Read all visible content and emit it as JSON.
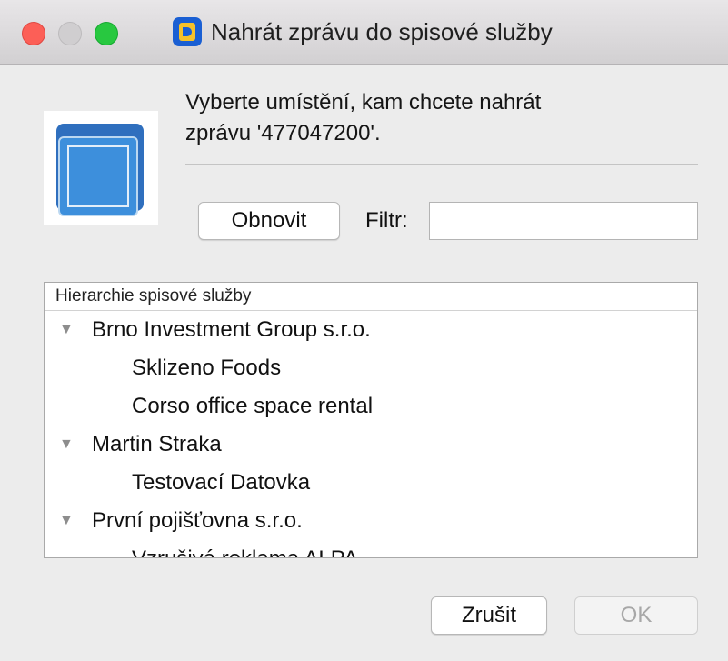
{
  "window": {
    "title": "Nahrát zprávu do spisové služby",
    "traffic_colors": {
      "close": "#fc5f57",
      "minimize": "#d0ced0",
      "maximize": "#28c840"
    }
  },
  "prompt": {
    "line1": "Vyberte umístění, kam chcete nahrát",
    "line2": "zprávu '477047200'."
  },
  "toolbar": {
    "refresh_label": "Obnovit",
    "filter_label": "Filtr:",
    "filter_value": ""
  },
  "tree": {
    "header": "Hierarchie spisové služby",
    "rows": [
      {
        "label": "Brno Investment Group s.r.o.",
        "expanded": true,
        "level": 0
      },
      {
        "label": "Sklizeno Foods",
        "level": 1
      },
      {
        "label": "Corso office space rental",
        "level": 1
      },
      {
        "label": "Martin Straka",
        "expanded": true,
        "level": 0
      },
      {
        "label": "Testovací Datovka",
        "level": 1
      },
      {
        "label": "První pojišťovna s.r.o.",
        "expanded": true,
        "level": 0
      },
      {
        "label": "Vzrušivá reklama ALPA",
        "level": 1
      }
    ]
  },
  "footer": {
    "cancel_label": "Zrušit",
    "ok_label": "OK"
  },
  "icons": {
    "app": "app-d-icon",
    "logo": "blue-cube-icon",
    "disclosure": "disclosure-triangle-down-icon"
  }
}
